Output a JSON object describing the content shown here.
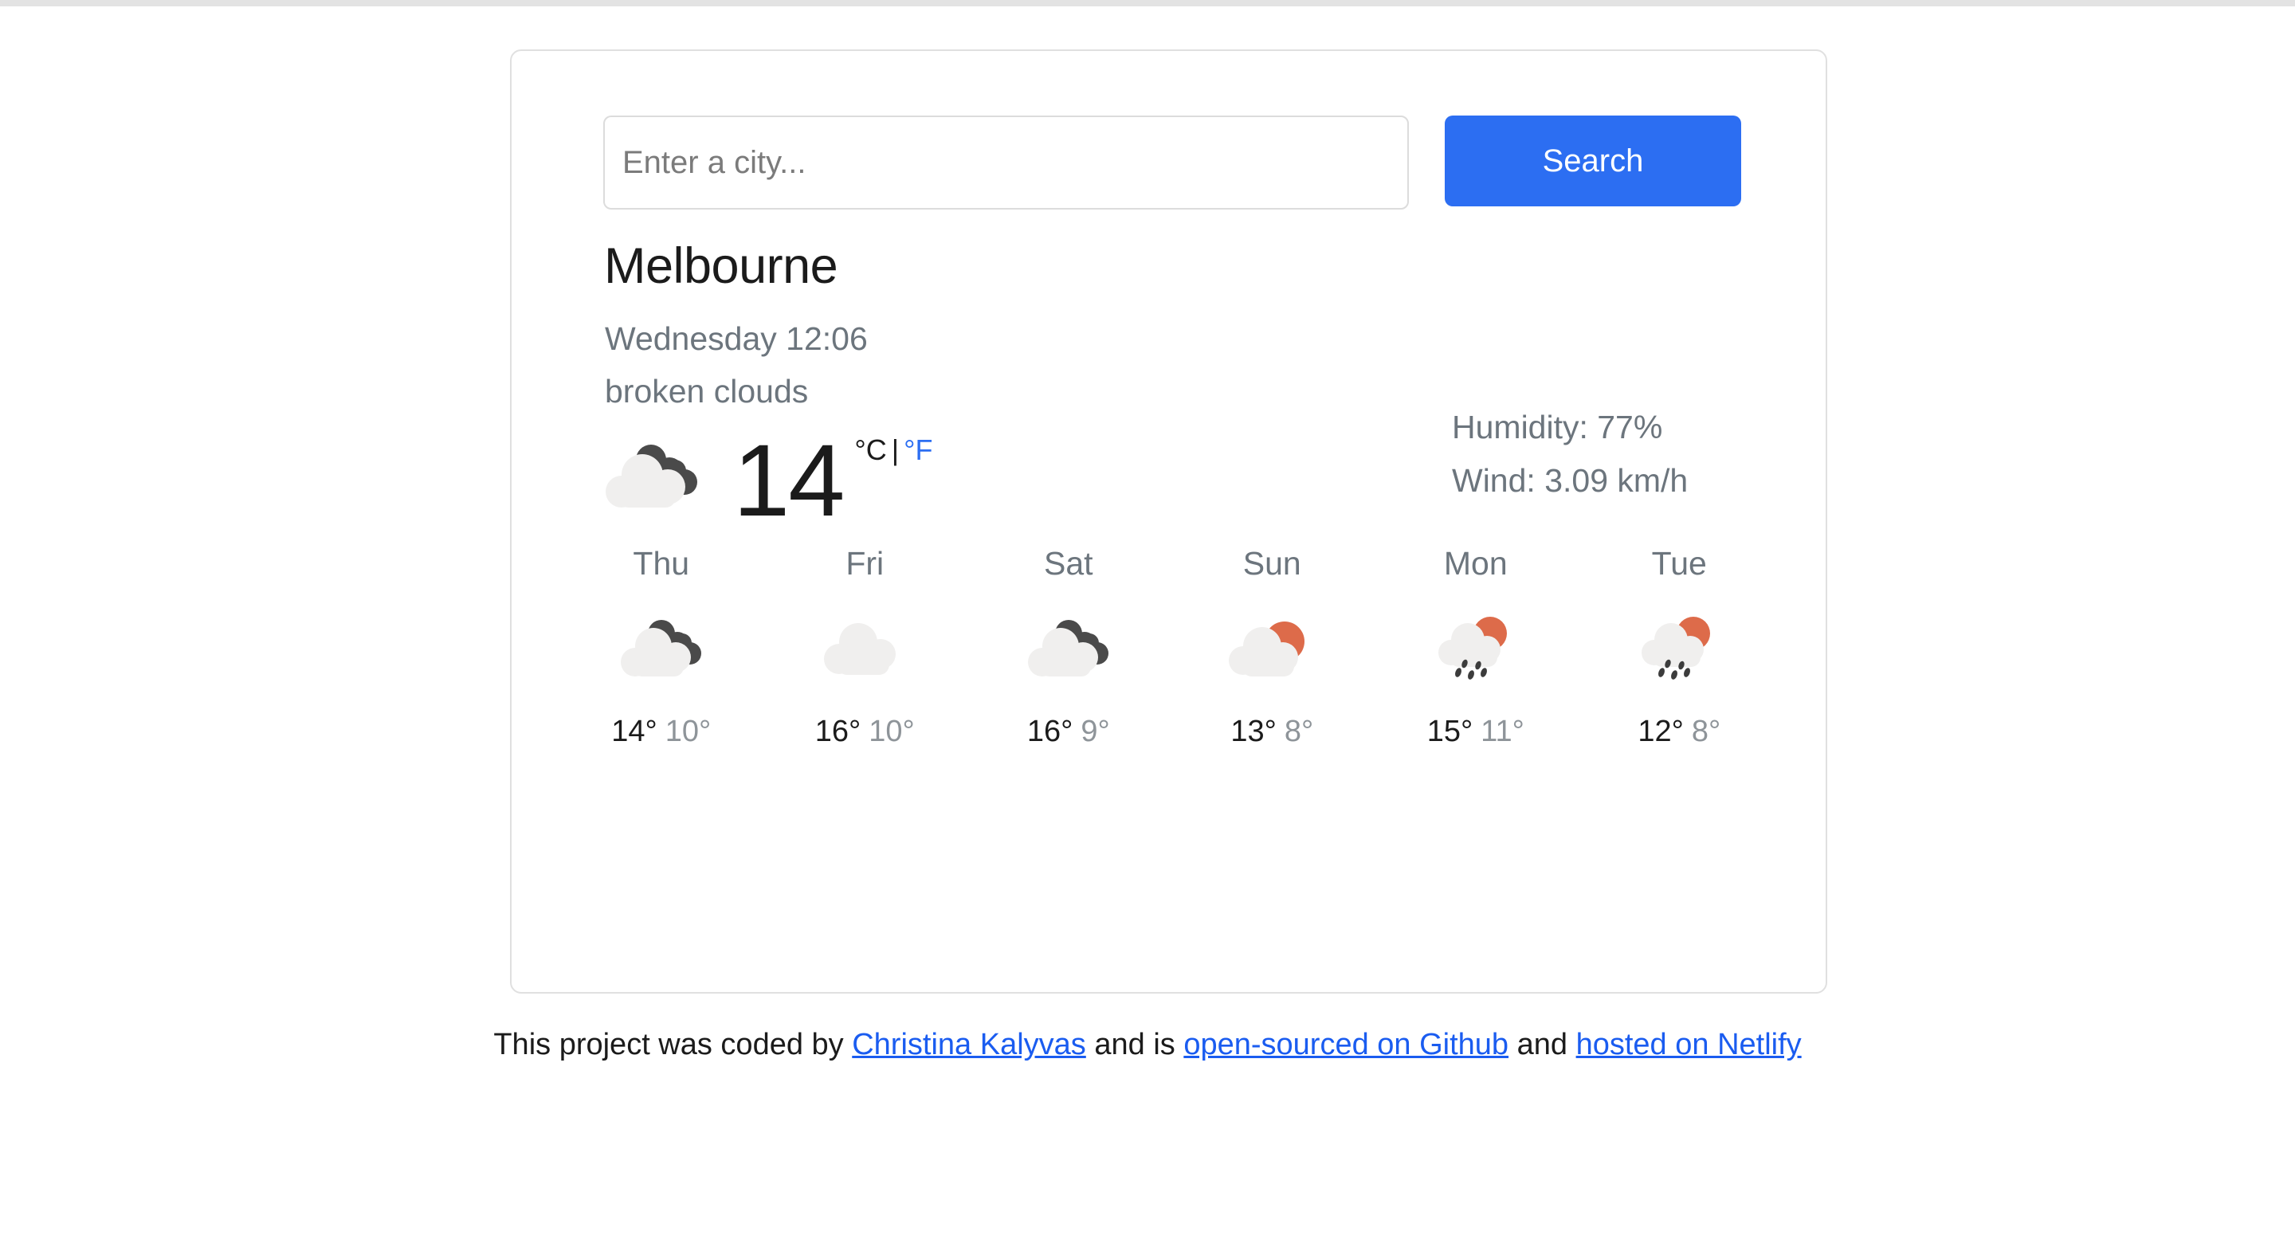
{
  "search": {
    "placeholder": "Enter a city...",
    "value": "",
    "button_label": "Search"
  },
  "current": {
    "city": "Melbourne",
    "datetime": "Wednesday 12:06",
    "description": "broken clouds",
    "temperature": "14",
    "unit_celsius": "°C",
    "unit_separator": "|",
    "unit_fahrenheit": "°F",
    "active_unit": "celsius",
    "icon": "broken-clouds-icon",
    "humidity": "Humidity: 77%",
    "wind": "Wind: 3.09 km/h"
  },
  "forecast": [
    {
      "day": "Thu",
      "icon": "broken-clouds-icon",
      "max": "14°",
      "min": "10°"
    },
    {
      "day": "Fri",
      "icon": "cloud-icon",
      "max": "16°",
      "min": "10°"
    },
    {
      "day": "Sat",
      "icon": "broken-clouds-icon",
      "max": "16°",
      "min": "9°"
    },
    {
      "day": "Sun",
      "icon": "sun-behind-cloud-icon",
      "max": "13°",
      "min": "8°"
    },
    {
      "day": "Mon",
      "icon": "sun-cloud-rain-icon",
      "max": "15°",
      "min": "11°"
    },
    {
      "day": "Tue",
      "icon": "sun-cloud-rain-icon",
      "max": "12°",
      "min": "8°"
    }
  ],
  "footer": {
    "prefix": "This project was coded by ",
    "author_link": "Christina Kalyvas",
    "middle": " and is ",
    "github_link": "open-sourced on Github",
    "middle2": " and ",
    "netlify_link": "hosted on Netlify"
  },
  "colors": {
    "accent_blue": "#2c6ef2",
    "link_blue": "#1a5cf0",
    "sun_orange": "#dd6b4a",
    "cloud_light": "#f0efee",
    "cloud_dark": "#4a4a4a",
    "text_muted": "#6c757d",
    "text_dark": "#1b1b1b",
    "card_border": "#e0e0e0"
  }
}
